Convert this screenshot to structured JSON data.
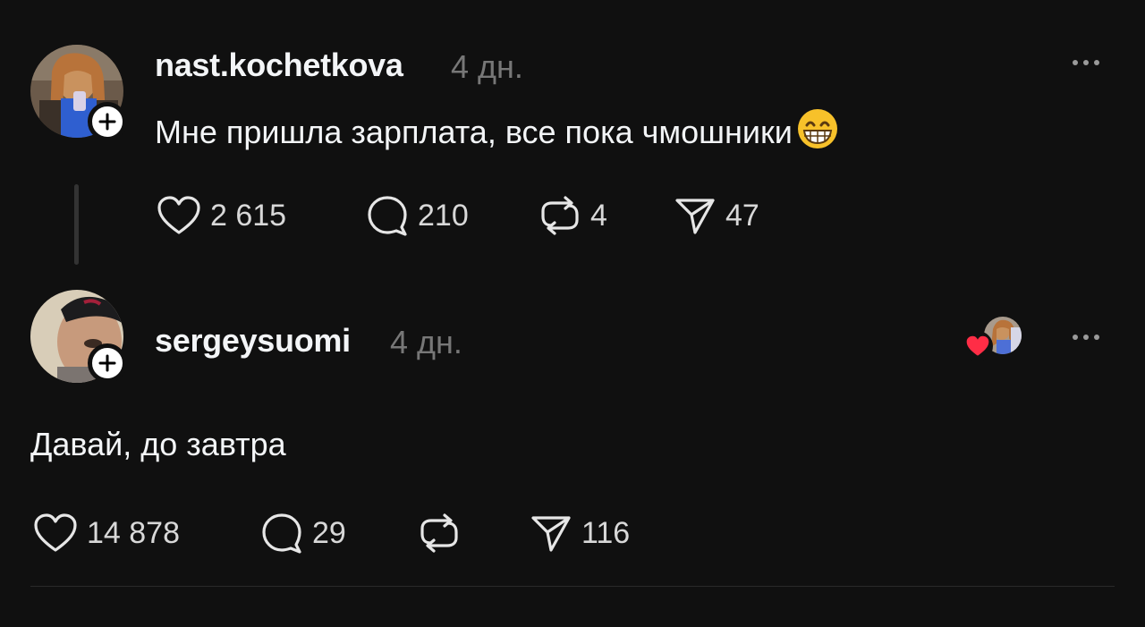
{
  "posts": [
    {
      "username": "nast.kochetkova",
      "time": "4 дн.",
      "text": "Мне пришла зарплата, все пока чмошники",
      "emoji": "grinning-face-with-smiling-eyes",
      "likes": "2 615",
      "replies": "210",
      "reposts": "4",
      "shares": "47"
    },
    {
      "username": "sergeysuomi",
      "time": "4 дн.",
      "text": "Давай, до завтра",
      "likes": "14 878",
      "replies": "29",
      "reposts": "",
      "shares": "116"
    }
  ],
  "colors": {
    "background": "#101010",
    "text": "#f3f5f7",
    "muted": "#777777",
    "heart_red": "#ff2d46"
  }
}
